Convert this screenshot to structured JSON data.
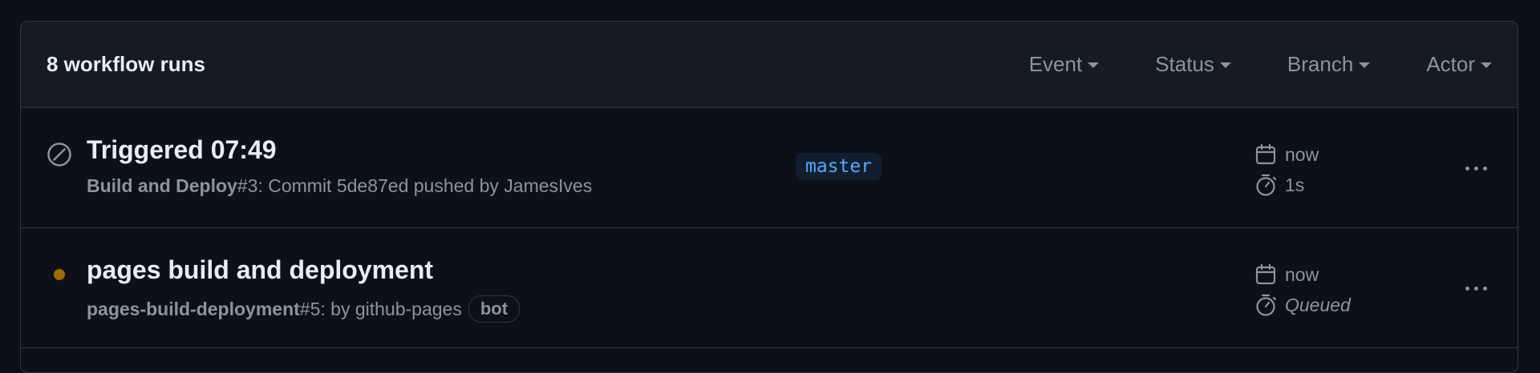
{
  "header": {
    "run_count": "8 workflow runs",
    "filters": [
      {
        "label": "Event"
      },
      {
        "label": "Status"
      },
      {
        "label": "Branch"
      },
      {
        "label": "Actor"
      }
    ]
  },
  "runs": [
    {
      "status": "cancelled",
      "title": "Triggered 07:49",
      "workflow": "Build and Deploy",
      "run_number": "#3",
      "detail": ": Commit 5de87ed pushed by JamesIves",
      "branch": "master",
      "time": "now",
      "duration": "1s"
    },
    {
      "status": "queued",
      "status_color": "#9e6a03",
      "title": "pages build and deployment",
      "workflow": "pages-build-deployment",
      "run_number": "#5",
      "detail": ": by github-pages",
      "badge": "bot",
      "time": "now",
      "duration": "Queued"
    }
  ]
}
